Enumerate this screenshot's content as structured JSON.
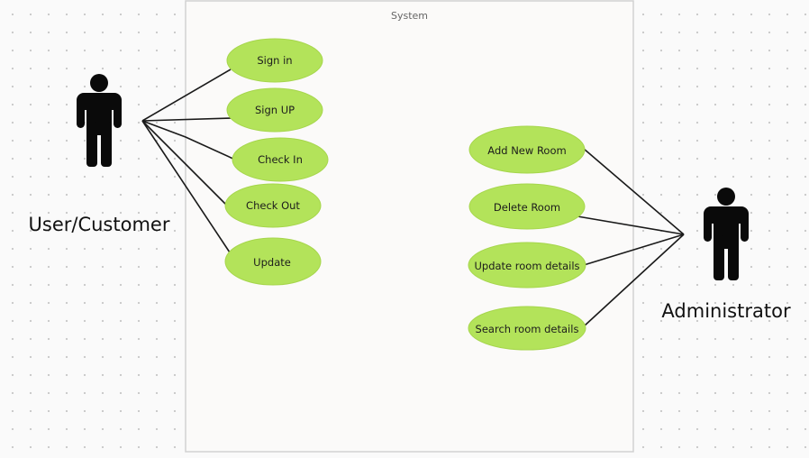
{
  "system": {
    "title": "System"
  },
  "actors": [
    {
      "id": "user",
      "label": "User/Customer"
    },
    {
      "id": "admin",
      "label": "Administrator"
    }
  ],
  "use_cases": [
    {
      "id": "sign-in",
      "label": "Sign in",
      "actor": "user"
    },
    {
      "id": "sign-up",
      "label": "Sign UP",
      "actor": "user"
    },
    {
      "id": "check-in",
      "label": "Check In",
      "actor": "user"
    },
    {
      "id": "check-out",
      "label": "Check Out",
      "actor": "user"
    },
    {
      "id": "update",
      "label": "Update",
      "actor": "user"
    },
    {
      "id": "add-new-room",
      "label": "Add New Room",
      "actor": "admin"
    },
    {
      "id": "delete-room",
      "label": "Delete Room",
      "actor": "admin"
    },
    {
      "id": "update-room-details",
      "label": "Update room details",
      "actor": "admin"
    },
    {
      "id": "search-room-details",
      "label": "Search room details",
      "actor": "admin"
    }
  ],
  "colors": {
    "usecase_fill": "#b3e35a",
    "system_fill": "#fbfaf9",
    "actor": "#0a0a0a"
  },
  "icons": [
    "person-icon"
  ]
}
